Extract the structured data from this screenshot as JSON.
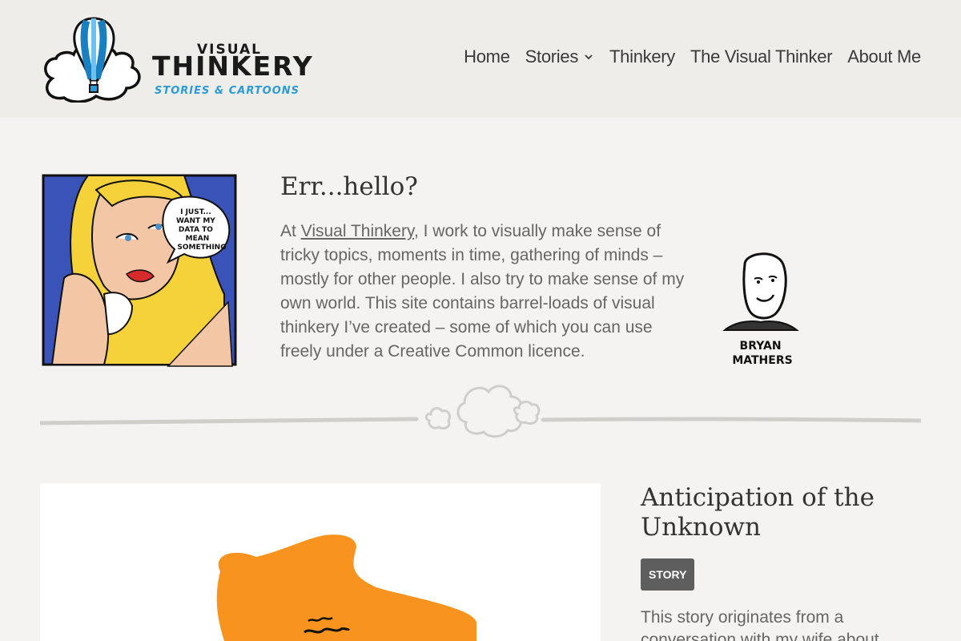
{
  "site": {
    "logo_top": "VISUAL",
    "logo_main": "THINKERY",
    "logo_sub": "STORIES & CARTOONS"
  },
  "nav": {
    "items": [
      {
        "label": "Home"
      },
      {
        "label": "Stories",
        "has_dropdown": true
      },
      {
        "label": "Thinkery"
      },
      {
        "label": "The Visual Thinker"
      },
      {
        "label": "About Me"
      }
    ]
  },
  "intro": {
    "title": "Err...hello?",
    "body_before": "At ",
    "link_text": "Visual Thinkery",
    "body_after": ", I work to visually make sense of tricky topics, moments in time, gathering of minds – mostly for other people. I also try to make sense of my own world. This site contains barrel-loads of visual thinkery I’ve created – some of which you can use freely under a Creative Common licence.",
    "comic_speech": [
      "I JUST...",
      "WANT MY",
      "DATA TO",
      "MEAN",
      "SOMETHING"
    ],
    "avatar_caption": [
      "BRYAN",
      "MATHERS"
    ]
  },
  "featured": {
    "title": "Anticipation of the Unknown",
    "badge": "STORY",
    "excerpt": "This story originates from a conversation with my wife about"
  },
  "colors": {
    "header_bg": "#efedea",
    "page_bg": "#f4f3f1",
    "badge_bg": "#5e5e5e",
    "logo_blue": "#2b9bd6",
    "blob_orange": "#f7931e"
  }
}
